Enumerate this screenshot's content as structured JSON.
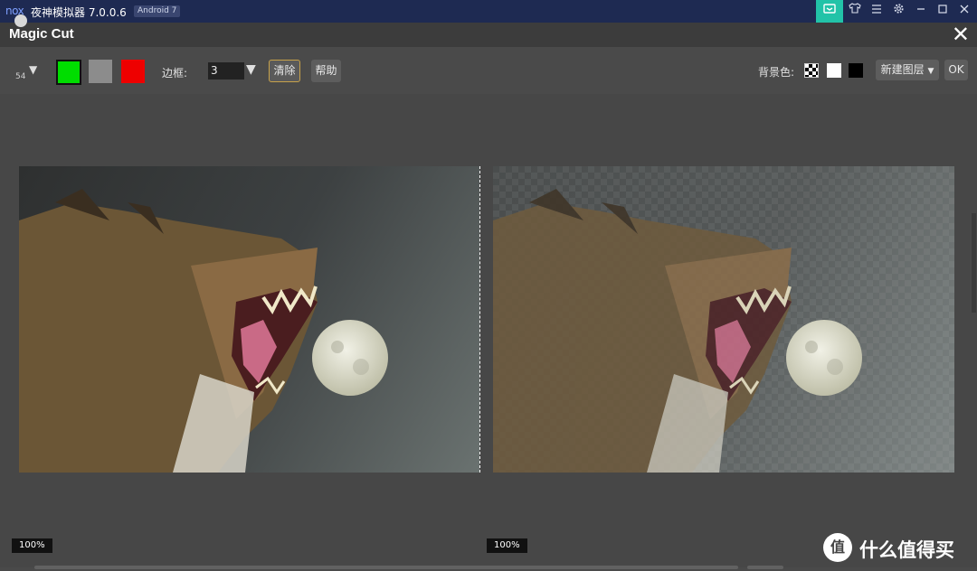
{
  "titlebar": {
    "logo": "nox",
    "title": "夜神模拟器 7.0.0.6",
    "badge": "Android 7",
    "icons": [
      "keyboard-icon",
      "shirt-icon",
      "menu-icon",
      "gear-icon",
      "minimize-icon",
      "maximize-icon",
      "close-icon"
    ],
    "active_color": "#22c3a8"
  },
  "header": {
    "title": "Magic Cut",
    "close": "✕"
  },
  "toolbar": {
    "brush_size": "54",
    "colors": [
      "#00dd00",
      "#8c8c8c",
      "#ee0000"
    ],
    "border_label": "边框:",
    "border_value": "3",
    "clear_label": "清除",
    "help_label": "帮助",
    "bg_label": "背景色:",
    "new_layer_label": "新建图层",
    "ok_label": "OK"
  },
  "canvas": {
    "left_zoom": "100%",
    "right_zoom": "100%"
  },
  "watermark": {
    "icon_text": "值",
    "text": "什么值得买"
  }
}
